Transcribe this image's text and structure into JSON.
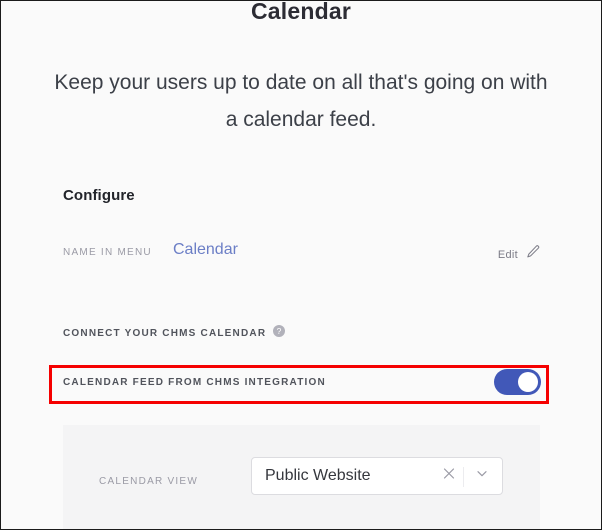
{
  "header": {
    "title": "Calendar",
    "subtitle": "Keep your users up to date on all that's going on with a calendar feed."
  },
  "configure": {
    "heading": "Configure",
    "name_in_menu": {
      "label": "NAME IN MENU",
      "value": "Calendar",
      "value_color": "#6b7ec6"
    },
    "edit": {
      "label": "Edit",
      "icon": "pencil-icon"
    }
  },
  "connect_chms": {
    "label": "CONNECT YOUR CHMS CALENDAR",
    "help_icon": "help-circle-icon"
  },
  "calendar_feed": {
    "label": "CALENDAR FEED FROM CHMS INTEGRATION",
    "toggle_state": "on",
    "toggle_color": "#4158b8"
  },
  "calendar_view": {
    "label": "CALENDAR VIEW",
    "selected_value": "Public Website",
    "clear_icon": "close-icon",
    "dropdown_icon": "chevron-down-icon"
  },
  "annotation": {
    "highlight_color": "#f50000",
    "target": "calendar-feed-row"
  }
}
